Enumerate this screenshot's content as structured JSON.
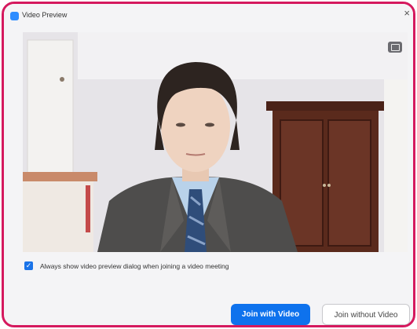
{
  "window": {
    "title": "Video Preview",
    "close_label": "×"
  },
  "preview": {
    "camera_icon": "camera-toggle-icon"
  },
  "options": {
    "always_show_label": "Always show video preview dialog when joining a video meeting",
    "always_show_checked": true
  },
  "actions": {
    "join_with_video": "Join with Video",
    "join_without_video": "Join without Video"
  },
  "colors": {
    "frame_border": "#d5195e",
    "primary_button": "#0e72ed",
    "checkbox": "#1a73e8"
  }
}
